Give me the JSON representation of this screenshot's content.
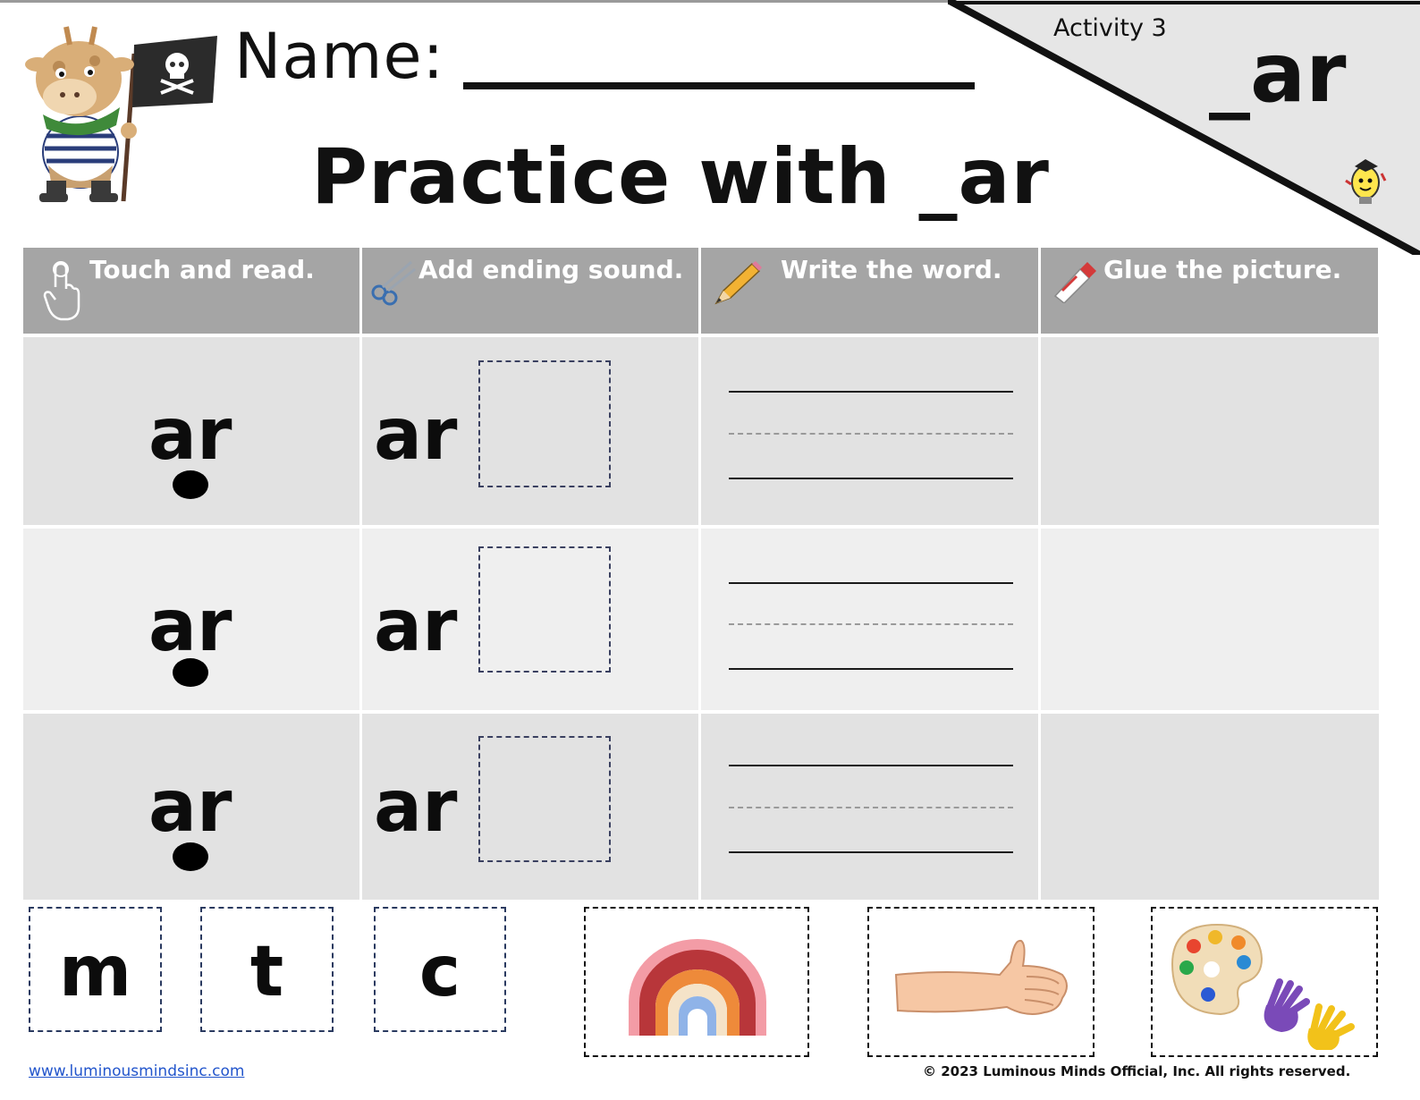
{
  "header": {
    "name_label": "Name:",
    "title": "Practice with _ar",
    "activity": "Activity 3",
    "corner_sound": "_ar"
  },
  "columns": [
    {
      "label": "Touch and read.",
      "icon": "finger-touch-icon"
    },
    {
      "label": "Add ending sound.",
      "icon": "scissors-icon"
    },
    {
      "label": "Write the word.",
      "icon": "pencil-icon"
    },
    {
      "label": "Glue the picture.",
      "icon": "glue-stick-icon"
    }
  ],
  "rows": [
    {
      "read": "ar",
      "stem": "ar"
    },
    {
      "read": "ar",
      "stem": "ar"
    },
    {
      "read": "ar",
      "stem": "ar"
    }
  ],
  "cutouts": {
    "letters": [
      "m",
      "t",
      "c"
    ],
    "pictures": [
      "rainbow-picture",
      "arm-picture",
      "paint-palette-picture"
    ]
  },
  "footer": {
    "website": "www.luminousmindsinc.com",
    "copyright": "© 2023 Luminous Minds Official, Inc. All rights reserved."
  },
  "colors": {
    "header_bg": "#a5a5a5",
    "row_dark": "#e2e2e2",
    "row_light": "#efefef",
    "corner_bg": "#e6e6e6"
  }
}
